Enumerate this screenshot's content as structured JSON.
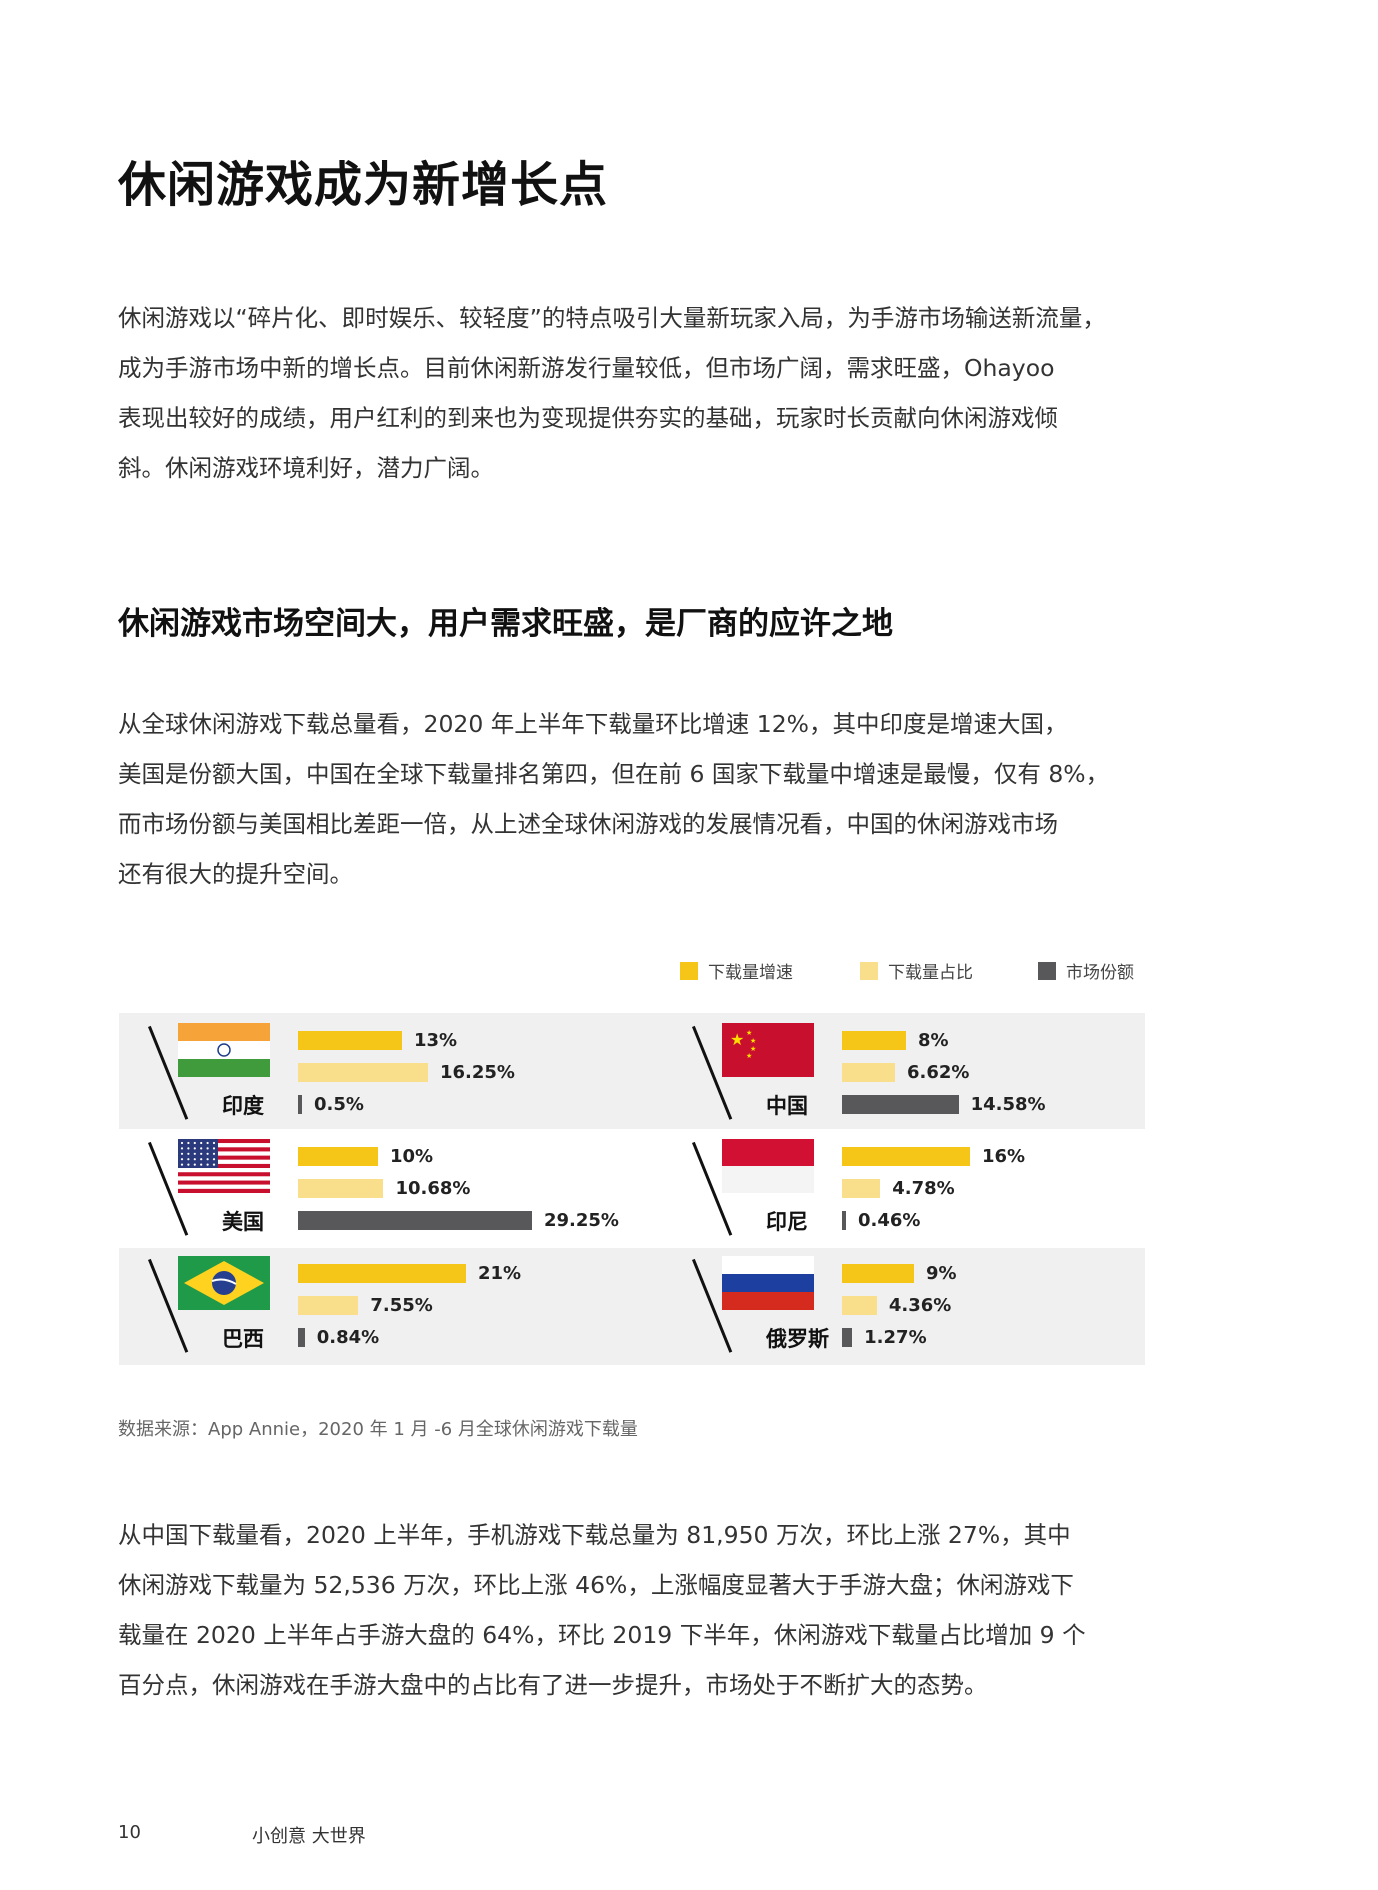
{
  "page": {
    "title": "休闲游戏成为新增长点",
    "intro_lines": [
      "休闲游戏以“碎片化、即时娱乐、较轻度”的特点吸引大量新玩家入局，为手游市场输送新流量，",
      "成为手游市场中新的增长点。目前休闲新游发行量较低，但市场广阔，需求旺盛，Ohayoo",
      "表现出较好的成绩，用户红利的到来也为变现提供夯实的基础，玩家时长贡献向休闲游戏倾",
      "斜。休闲游戏环境利好，潜力广阔。"
    ],
    "subheading": "休闲游戏市场空间大，用户需求旺盛，是厂商的应许之地",
    "analysis_lines": [
      "从全球休闲游戏下载总量看，2020 年上半年下载量环比增速 12%，其中印度是增速大国，",
      "美国是份额大国，中国在全球下载量排名第四，但在前 6 国家下载量中增速是最慢，仅有 8%，",
      "而市场份额与美国相比差距一倍，从上述全球休闲游戏的发展情况看，中国的休闲游戏市场",
      "还有很大的提升空间。"
    ],
    "source_note": "数据来源：App Annie，2020 年 1 月 -6 月全球休闲游戏下载量",
    "china_lines": [
      "从中国下载量看，2020 上半年，手机游戏下载总量为 81,950 万次，环比上涨 27%，其中",
      "休闲游戏下载量为 52,536 万次，环比上涨 46%，上涨幅度显著大于手游大盘；休闲游戏下",
      "载量在 2020 上半年占手游大盘的 64%，环比 2019 下半年，休闲游戏下载量占比增加 9 个",
      "百分点，休闲游戏在手游大盘中的占比有了进一步提升，市场处于不断扩大的态势。"
    ],
    "footer": {
      "page_number": "10",
      "tagline": "小创意  大世界"
    }
  },
  "chart_data": {
    "type": "bar",
    "orientation": "horizontal",
    "legend_position": "top-right",
    "series": [
      {
        "name": "下载量增速",
        "color": "#f5c518"
      },
      {
        "name": "下载量占比",
        "color": "#f9df8c"
      },
      {
        "name": "市场份额",
        "color": "#58585a"
      }
    ],
    "categories": [
      "印度",
      "中国",
      "美国",
      "印尼",
      "巴西",
      "俄罗斯"
    ],
    "values": {
      "下载量增速": [
        13,
        8,
        10,
        16,
        21,
        9
      ],
      "下载量占比": [
        16.25,
        6.62,
        10.68,
        4.78,
        7.55,
        4.36
      ],
      "市场份额": [
        0.5,
        14.58,
        29.25,
        0.46,
        0.84,
        1.27
      ]
    },
    "labels": {
      "下载量增速": [
        "13%",
        "8%",
        "10%",
        "16%",
        "21%",
        "9%"
      ],
      "下载量占比": [
        "16.25%",
        "6.62%",
        "10.68%",
        "4.78%",
        "7.55%",
        "4.36%"
      ],
      "市场份额": [
        "0.5%",
        "14.58%",
        "29.25%",
        "0.46%",
        "0.84%",
        "1.27%"
      ]
    },
    "flags": [
      "india-flag-icon",
      "china-flag-icon",
      "usa-flag-icon",
      "indonesia-flag-icon",
      "brazil-flag-icon",
      "russia-flag-icon"
    ]
  }
}
